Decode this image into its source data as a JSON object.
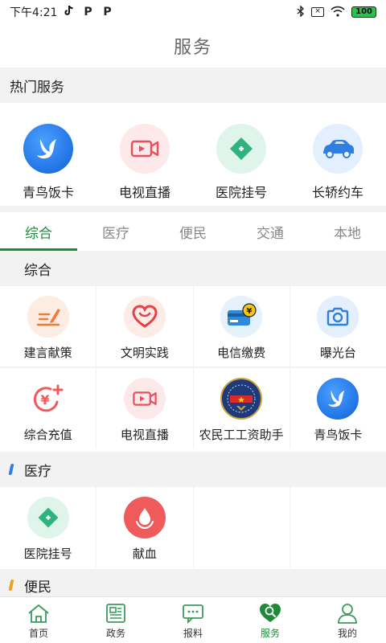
{
  "status_bar": {
    "time": "下午4:21",
    "apps": [
      "tiktok-icon",
      "P",
      "P"
    ],
    "battery": "100",
    "icons": [
      "bluetooth-icon",
      "sim-icon",
      "wifi-icon"
    ]
  },
  "header": {
    "title": "服务"
  },
  "hot_services": {
    "title": "热门服务",
    "items": [
      {
        "label": "青鸟饭卡",
        "icon": "bird-icon"
      },
      {
        "label": "电视直播",
        "icon": "video-icon"
      },
      {
        "label": "医院挂号",
        "icon": "medical-cross-icon"
      },
      {
        "label": "长轿约车",
        "icon": "car-icon"
      }
    ]
  },
  "tabs": {
    "items": [
      "综合",
      "医疗",
      "便民",
      "交通",
      "本地"
    ],
    "active_index": 0
  },
  "sections": {
    "general": {
      "title": "综合",
      "items": [
        {
          "label": "建言献策",
          "icon": "pen-icon"
        },
        {
          "label": "文明实践",
          "icon": "heart-icon"
        },
        {
          "label": "电信缴费",
          "icon": "card-payment-icon"
        },
        {
          "label": "曝光台",
          "icon": "camera-icon"
        },
        {
          "label": "综合充值",
          "icon": "yuan-recharge-icon"
        },
        {
          "label": "电视直播",
          "icon": "video-icon"
        },
        {
          "label": "农民工工资助手",
          "icon": "labor-badge-icon"
        },
        {
          "label": "青鸟饭卡",
          "icon": "bird-icon"
        }
      ]
    },
    "medical": {
      "title": "医疗",
      "accent": "#2f7fe0",
      "items": [
        {
          "label": "医院挂号",
          "icon": "medical-cross-icon"
        },
        {
          "label": "献血",
          "icon": "blood-drop-icon"
        }
      ]
    },
    "convenience": {
      "title": "便民",
      "accent": "#f0a020"
    }
  },
  "bottom_nav": {
    "items": [
      {
        "label": "首页",
        "icon": "home-icon"
      },
      {
        "label": "政务",
        "icon": "news-icon"
      },
      {
        "label": "报料",
        "icon": "chat-icon"
      },
      {
        "label": "服务",
        "icon": "service-icon"
      },
      {
        "label": "我的",
        "icon": "user-icon"
      }
    ],
    "active_index": 3
  },
  "colors": {
    "accent_green": "#1e8a3a",
    "background_gray": "#f2f2f2"
  }
}
